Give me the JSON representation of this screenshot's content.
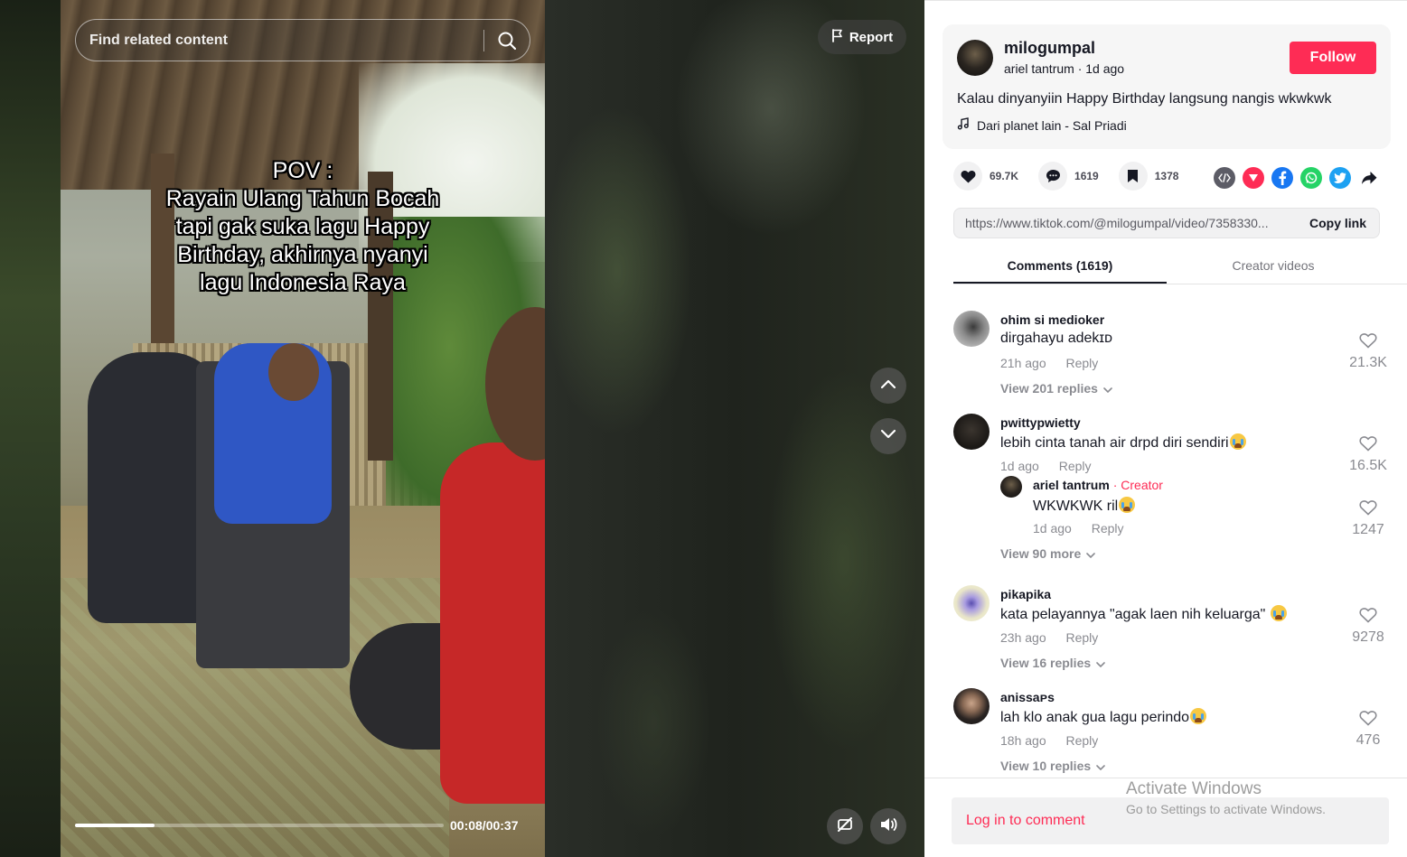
{
  "video": {
    "search_placeholder": "Find related content",
    "report_label": "Report",
    "overlay_lines": [
      "POV :",
      "Rayain Ulang Tahun Bocah",
      "tapi gak suka lagu Happy",
      "Birthday, akhirnya nyanyi",
      "lagu Indonesia Raya"
    ],
    "progress_fraction": 0.216,
    "time_display": "00:08/00:37"
  },
  "author": {
    "username": "milogumpal",
    "nickname": "ariel tantrum",
    "time_ago": "1d ago",
    "follow_label": "Follow",
    "caption": "Kalau dinyanyiin Happy Birthday langsung nangis wkwkwk",
    "music": "Dari planet lain - Sal Priadi"
  },
  "stats": {
    "likes": "69.7K",
    "comments": "1619",
    "saves": "1378"
  },
  "share_icons": [
    "embed-icon",
    "send-icon",
    "facebook-icon",
    "whatsapp-icon",
    "twitter-icon",
    "share-arrow-icon"
  ],
  "link": {
    "url": "https://www.tiktok.com/@milogumpal/video/7358330...",
    "copy_label": "Copy link"
  },
  "tabs": {
    "comments": "Comments (1619)",
    "creator_videos": "Creator videos"
  },
  "comments": [
    {
      "user": "ohim si medioker",
      "text": "dirgahayu adekɪᴅ",
      "time": "21h ago",
      "reply": "Reply",
      "likes": "21.3K",
      "view_replies": "View 201 replies"
    },
    {
      "user": "pwittypwietty",
      "text": "lebih cinta tanah air drpd diri sendiri",
      "time": "1d ago",
      "reply": "Reply",
      "likes": "16.5K"
    },
    {
      "user": "ariel tantrum",
      "separator": " · ",
      "creator_tag": "Creator",
      "text": "WKWKWK ril",
      "time": "1d ago",
      "reply": "Reply",
      "likes": "1247",
      "view_more": "View 90 more"
    },
    {
      "user": "pikapika",
      "text": "kata pelayannya \"agak laen nih keluarga\" ",
      "time": "23h ago",
      "reply": "Reply",
      "likes": "9278",
      "view_replies": "View 16 replies"
    },
    {
      "user": "anissaᴘs",
      "text": "lah klo anak gua lagu perindo",
      "time": "18h ago",
      "reply": "Reply",
      "likes": "476",
      "view_replies": "View 10 replies"
    }
  ],
  "login_prompt": "Log in to comment",
  "watermark": {
    "title": "Activate Windows",
    "subtitle": "Go to Settings to activate Windows."
  },
  "colors": {
    "brand": "#fe2c55",
    "text_primary": "#161823",
    "text_secondary": "#8a8b91"
  }
}
